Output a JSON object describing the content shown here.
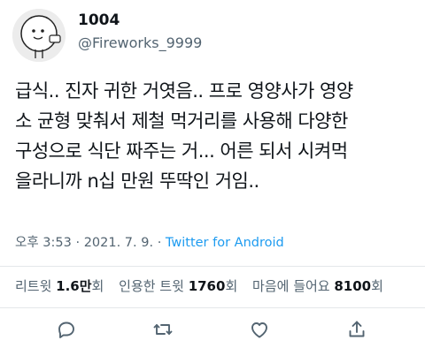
{
  "author": {
    "display_name": "1004",
    "handle": "@Fireworks_9999",
    "avatar_icon": "cartoon-character-avatar"
  },
  "tweet": {
    "text": "급식.. 진자 귀한 거엿음.. 프로 영양사가 영양소 균형 맞춰서 제철 먹거리를 사용해 다양한 구성으로 식단 짜주는 거... 어른 되서 시켜먹을라니까 n십 만원 뚜딱인 거임..",
    "lines": [
      "급식.. 진자 귀한 거엿음.. 프로 영양사가 영양",
      "소 균형 맞춰서 제철 먹거리를 사용해 다양한",
      "구성으로 식단 짜주는 거... 어른 되서 시켜먹",
      "을라니까 n십 만원 뚜딱인 거임.."
    ]
  },
  "meta": {
    "time": "오후 3:53",
    "sep1": " · ",
    "date": "2021. 7. 9.",
    "sep2": " · ",
    "client": "Twitter for Android"
  },
  "stats": {
    "retweets_label_prefix": "리트윗 ",
    "retweets_value": "1.6만",
    "retweets_suffix": "회",
    "quotes_label_prefix": "인용한 트윗 ",
    "quotes_value": "1760",
    "quotes_suffix": "회",
    "likes_label_prefix": "마음에 들어요 ",
    "likes_value": "8100",
    "likes_suffix": "회"
  },
  "actions": [
    {
      "name": "reply-icon"
    },
    {
      "name": "retweet-icon"
    },
    {
      "name": "like-icon"
    },
    {
      "name": "share-icon"
    }
  ],
  "colors": {
    "text": "#0f1419",
    "secondary": "#536471",
    "link": "#1d9bf0",
    "divider": "#e4e7ea"
  }
}
